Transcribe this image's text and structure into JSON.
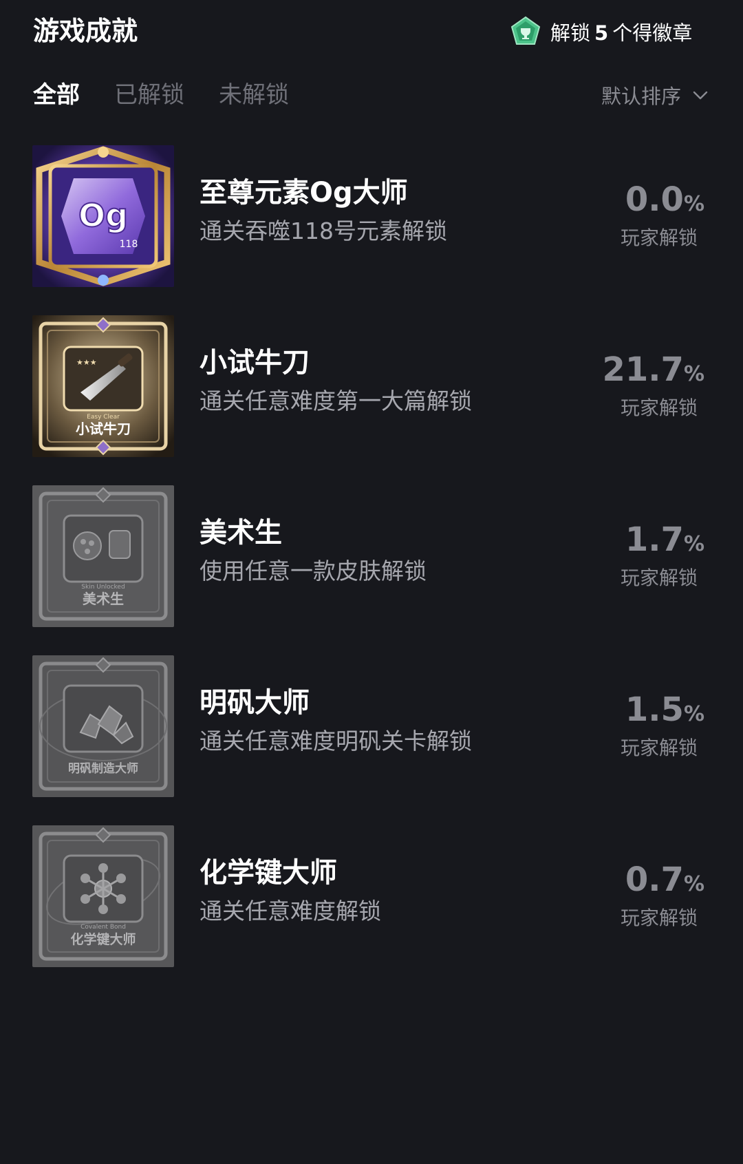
{
  "header": {
    "title": "游戏成就",
    "badge_promo": {
      "icon": "badge-pentagon-icon",
      "prefix": "解锁",
      "count": "5",
      "suffix": "个得徽章",
      "color": "#4cc38a"
    }
  },
  "tabs": [
    {
      "label": "全部",
      "active": true
    },
    {
      "label": "已解锁",
      "active": false
    },
    {
      "label": "未解锁",
      "active": false
    }
  ],
  "sort": {
    "label": "默认排序",
    "icon": "chevron-down-icon"
  },
  "achievements": [
    {
      "title": "至尊元素Og大师",
      "description": "通关吞噬118号元素解锁",
      "percent": "0.0",
      "percent_sign": "%",
      "stat_label": "玩家解锁",
      "badge_text": "Og",
      "badge_number": "118",
      "badge_icon": "element-og-badge-icon",
      "locked": false
    },
    {
      "title": "小试牛刀",
      "description": "通关任意难度第一大篇解锁",
      "percent": "21.7",
      "percent_sign": "%",
      "stat_label": "玩家解锁",
      "badge_caption": "Easy Clear",
      "badge_text": "小试牛刀",
      "badge_icon": "knife-badge-icon",
      "locked": false
    },
    {
      "title": "美术生",
      "description": "使用任意一款皮肤解锁",
      "percent": "1.7",
      "percent_sign": "%",
      "stat_label": "玩家解锁",
      "badge_caption": "Skin Unlocked",
      "badge_text": "美术生",
      "badge_icon": "palette-badge-icon",
      "locked": true
    },
    {
      "title": "明矾大师",
      "description": "通关任意难度明矾关卡解锁",
      "percent": "1.5",
      "percent_sign": "%",
      "stat_label": "玩家解锁",
      "badge_text": "明矾制造大师",
      "badge_icon": "crystal-badge-icon",
      "locked": true
    },
    {
      "title": "化学键大师",
      "description": "通关任意难度解锁",
      "percent": "0.7",
      "percent_sign": "%",
      "stat_label": "玩家解锁",
      "badge_caption": "Covalent Bond",
      "badge_text": "化学键大师",
      "badge_icon": "molecule-badge-icon",
      "locked": true
    }
  ]
}
